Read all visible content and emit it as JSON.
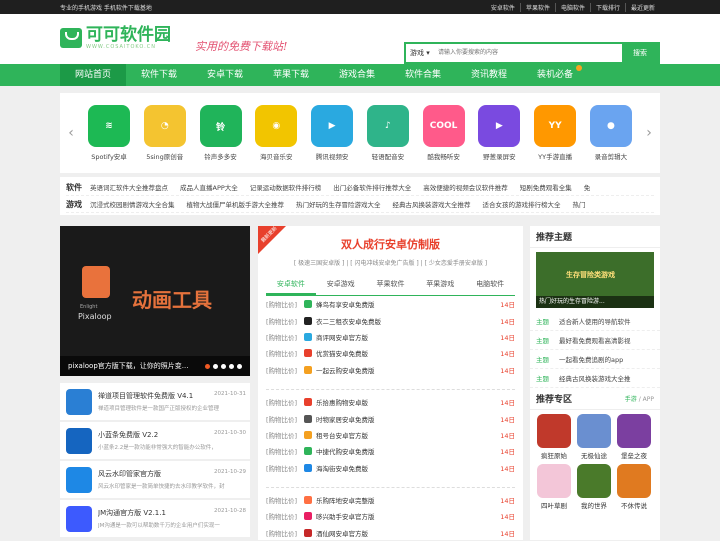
{
  "topbar": {
    "tagline": "专业的手机游戏 手机软件下载基地",
    "links": [
      "安卓软件",
      "苹果软件",
      "电脑软件",
      "下载排行",
      "最近更新"
    ]
  },
  "logo": {
    "name": "可可软件园",
    "url": "WWW.COSAITOKO.CN"
  },
  "slogan": "实用的免费下载站!",
  "search": {
    "type": "游戏",
    "placeholder": "请输入你要搜索的内容",
    "button": "搜索"
  },
  "nav": [
    "网站首页",
    "软件下载",
    "安卓下载",
    "苹果下载",
    "游戏合集",
    "软件合集",
    "资讯教程",
    "装机必备"
  ],
  "apps": [
    {
      "label": "Spotify安卓",
      "color": "#1db954",
      "glyph": "≋"
    },
    {
      "label": "5sing原创音",
      "color": "#f4c430",
      "glyph": "◔"
    },
    {
      "label": "铃声多多安",
      "color": "#20b45a",
      "glyph": "铃"
    },
    {
      "label": "海贝音乐安",
      "color": "#f2c500",
      "glyph": "◉"
    },
    {
      "label": "腾讯视频安",
      "color": "#2aa9e0",
      "glyph": "▶"
    },
    {
      "label": "轻语配音安",
      "color": "#2fb48a",
      "glyph": "♪"
    },
    {
      "label": "酷我畅听安",
      "color": "#ff5a8a",
      "glyph": "COOL"
    },
    {
      "label": "野葱录屏安",
      "color": "#7a4ae0",
      "glyph": "▶"
    },
    {
      "label": "YY手游直播",
      "color": "#ff9800",
      "glyph": "YY"
    },
    {
      "label": "录音剪辑大",
      "color": "#6aa4f0",
      "glyph": "●"
    }
  ],
  "tags": {
    "software_label": "软件",
    "software": [
      "英语词汇软件大全推荐盘点",
      "成品人直播APP大全",
      "记录运动数据软件排行榜",
      "出门必备软件排行推荐大全",
      "高效便捷的视频会议软件推荐",
      "短剧免费观看全集",
      "免"
    ],
    "game_label": "游戏",
    "games": [
      "沉浸式校园剧情游戏大全合集",
      "植物大战僵尸单机版手游大全推荐",
      "热门好玩的生存冒险游戏大全",
      "经典古风换装游戏大全推荐",
      "适合女孩的游戏排行榜大全",
      "热门"
    ]
  },
  "banner": {
    "brand": "Pixaloop",
    "sub": "Enlight",
    "headline": "动画工具",
    "caption": "pixaloop官方版下载，让你的照片变..."
  },
  "left_list": [
    {
      "title": "禅道项目管理软件免费版 V4.1",
      "date": "2021-10-31",
      "desc": "禅道项目管理软件是一款国产正版授权的企业管理",
      "color": "#2a7fd4"
    },
    {
      "title": "小蓝条免费版 V2.2",
      "date": "2021-10-30",
      "desc": "小蓝条2.2是一款功能非常强大的智能办公软件，",
      "color": "#1565c0"
    },
    {
      "title": "风云水印管家官方版",
      "date": "2021-10-29",
      "desc": "风云水印管家是一款简单快捷的去水印教学软件，封",
      "color": "#1e88e5"
    },
    {
      "title": "JM沟通官方版 V2.1.1",
      "date": "2021-10-28",
      "desc": "JM沟通是一款可以帮助数千万的企业用户们实现一",
      "color": "#3d5afe"
    }
  ],
  "mid": {
    "ribbon": "最新更新",
    "title": "双人成行安卓仿制版",
    "subs": [
      "极速三国安卓版",
      "闪电冲线安卓免广告版",
      "少女恋爱手册安卓版"
    ],
    "tabs": [
      "安卓软件",
      "安卓游戏",
      "苹果软件",
      "苹果游戏",
      "电脑软件"
    ],
    "tag": "[购物比价]",
    "groups": [
      [
        {
          "name": "蜂鸟有享安卓免费版",
          "color": "#2fb45a"
        },
        {
          "name": "衣二三租衣安卓免费版",
          "color": "#222"
        },
        {
          "name": "商评网安卓官方版",
          "color": "#2aa9e0"
        },
        {
          "name": "优赏猫安卓免费版",
          "color": "#e8402c"
        },
        {
          "name": "一起云购安卓免费版",
          "color": "#f4a020"
        }
      ],
      [
        {
          "name": "乐拾惠购物安卓版",
          "color": "#e8402c"
        },
        {
          "name": "时物家居安卓免费版",
          "color": "#555"
        },
        {
          "name": "租号台安卓官方版",
          "color": "#f4a020"
        },
        {
          "name": "中捷代购安卓免费版",
          "color": "#2fb45a"
        },
        {
          "name": "海淘街安卓免费版",
          "color": "#1e88e5"
        }
      ],
      [
        {
          "name": "乐购阵地安卓完整版",
          "color": "#ff7043"
        },
        {
          "name": "哆兴助手安卓官方版",
          "color": "#e91e63"
        },
        {
          "name": "酒仙网安卓官方版",
          "color": "#c62828"
        }
      ]
    ],
    "date": "14日"
  },
  "right": {
    "topic_title": "推荐主题",
    "topic_banner_text": "生存冒险类游戏",
    "topic_banner_caption": "热门好玩的生存冒险游...",
    "topic_label": "主题",
    "topics": [
      "适合新人使用的导航软件",
      "最好看免费观看高清影视",
      "一起看免费追剧的app",
      "经典古风换装游戏大全推"
    ],
    "zone_title": "推荐专区",
    "zone_switch": [
      "手游",
      "APP"
    ],
    "zone": [
      {
        "name": "疯狂原始",
        "color": "#c0392b"
      },
      {
        "name": "无极仙途",
        "color": "#6a8fd0"
      },
      {
        "name": "堡垒之夜",
        "color": "#7b3fa0"
      },
      {
        "name": "四叶草剧",
        "color": "#f3c6d8"
      },
      {
        "name": "我的世界",
        "color": "#4a7a2a"
      },
      {
        "name": "不休传说",
        "color": "#e07a20"
      }
    ]
  }
}
